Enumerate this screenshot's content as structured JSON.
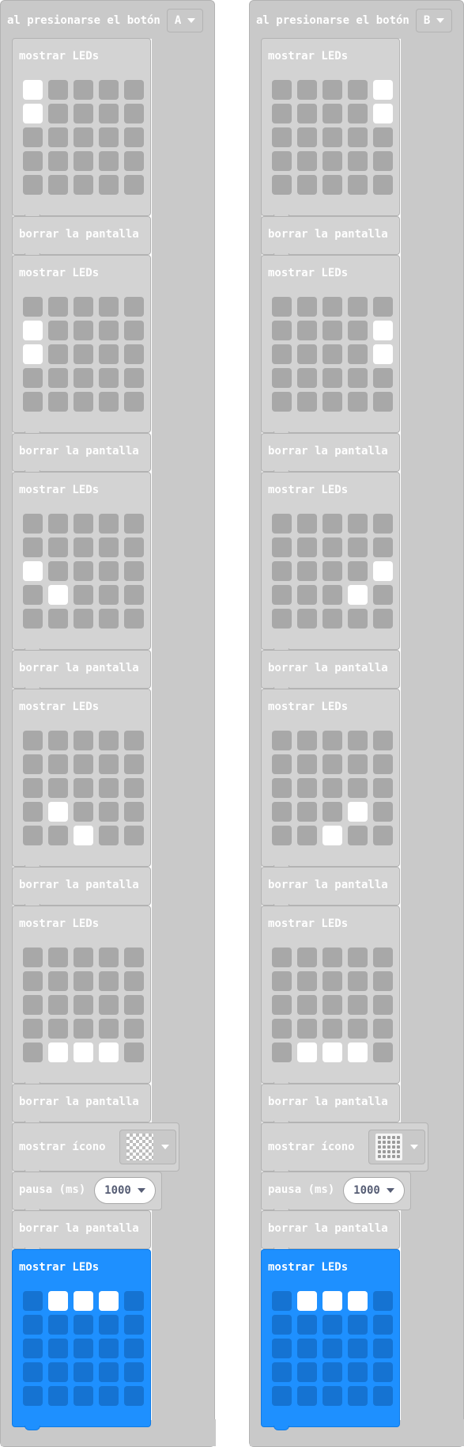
{
  "colors": {
    "hat": "#c9c9c9",
    "block": "#d3d3d3",
    "led_off": "#a8a8a8",
    "led_on": "#ffffff",
    "blue": "#1e90ff",
    "blue_led_off": "#1573d2"
  },
  "left": {
    "hat_label": "al presionarse el botón",
    "button_value": "A",
    "blocks": [
      {
        "type": "leds",
        "title": "mostrar LEDs",
        "on": [
          0,
          5
        ]
      },
      {
        "type": "clear",
        "title": "borrar la pantalla"
      },
      {
        "type": "leds",
        "title": "mostrar LEDs",
        "on": [
          5,
          10
        ]
      },
      {
        "type": "clear",
        "title": "borrar la pantalla"
      },
      {
        "type": "leds",
        "title": "mostrar LEDs",
        "on": [
          10,
          16
        ]
      },
      {
        "type": "clear",
        "title": "borrar la pantalla"
      },
      {
        "type": "leds",
        "title": "mostrar LEDs",
        "on": [
          16,
          22
        ]
      },
      {
        "type": "clear",
        "title": "borrar la pantalla"
      },
      {
        "type": "leds",
        "title": "mostrar LEDs",
        "on": [
          21,
          22,
          23
        ]
      },
      {
        "type": "clear",
        "title": "borrar la pantalla"
      },
      {
        "type": "icon",
        "title": "mostrar ícono",
        "icon_name": "checker-icon"
      },
      {
        "type": "pause",
        "title": "pausa (ms)",
        "value": "1000"
      },
      {
        "type": "clear",
        "title": "borrar la pantalla"
      },
      {
        "type": "leds",
        "title": "mostrar LEDs",
        "on": [
          1,
          2,
          3
        ],
        "highlight": true
      }
    ]
  },
  "right": {
    "hat_label": "al presionarse el botón",
    "button_value": "B",
    "blocks": [
      {
        "type": "leds",
        "title": "mostrar LEDs",
        "on": [
          4,
          9
        ]
      },
      {
        "type": "clear",
        "title": "borrar la pantalla"
      },
      {
        "type": "leds",
        "title": "mostrar LEDs",
        "on": [
          9,
          14
        ]
      },
      {
        "type": "clear",
        "title": "borrar la pantalla"
      },
      {
        "type": "leds",
        "title": "mostrar LEDs",
        "on": [
          14,
          18
        ]
      },
      {
        "type": "clear",
        "title": "borrar la pantalla"
      },
      {
        "type": "leds",
        "title": "mostrar LEDs",
        "on": [
          18,
          22
        ]
      },
      {
        "type": "clear",
        "title": "borrar la pantalla"
      },
      {
        "type": "leds",
        "title": "mostrar LEDs",
        "on": [
          21,
          22,
          23
        ]
      },
      {
        "type": "clear",
        "title": "borrar la pantalla"
      },
      {
        "type": "icon",
        "title": "mostrar ícono",
        "icon_name": "grid-icon"
      },
      {
        "type": "pause",
        "title": "pausa (ms)",
        "value": "1000"
      },
      {
        "type": "clear",
        "title": "borrar la pantalla"
      },
      {
        "type": "leds",
        "title": "mostrar LEDs",
        "on": [
          1,
          2,
          3
        ],
        "highlight": true
      }
    ]
  }
}
